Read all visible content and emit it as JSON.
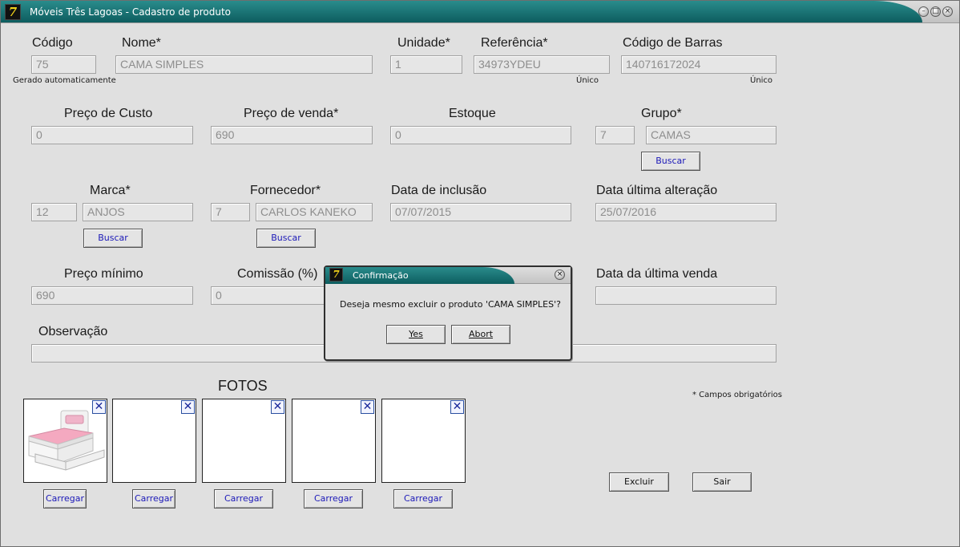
{
  "window": {
    "title": "Móveis Três Lagoas - Cadastro de produto",
    "logo": "7"
  },
  "form": {
    "codigo": {
      "label": "Código",
      "value": "75",
      "hint": "Gerado automaticamente"
    },
    "nome": {
      "label": "Nome*",
      "value": "CAMA SIMPLES"
    },
    "unidade": {
      "label": "Unidade*",
      "value": "1"
    },
    "referencia": {
      "label": "Referência*",
      "value": "34973YDEU",
      "hint": "Único"
    },
    "codigo_barras": {
      "label": "Código de Barras",
      "value": "140716172024",
      "hint": "Único"
    },
    "preco_custo": {
      "label": "Preço de Custo",
      "value": "0"
    },
    "preco_venda": {
      "label": "Preço de venda*",
      "value": "690"
    },
    "estoque": {
      "label": "Estoque",
      "value": "0"
    },
    "grupo": {
      "label": "Grupo*",
      "id": "7",
      "name": "CAMAS",
      "search_label": "Buscar"
    },
    "marca": {
      "label": "Marca*",
      "id": "12",
      "name": "ANJOS",
      "search_label": "Buscar"
    },
    "fornecedor": {
      "label": "Fornecedor*",
      "id": "7",
      "name": "CARLOS KANEKO",
      "search_label": "Buscar"
    },
    "data_inclusao": {
      "label": "Data de inclusão",
      "value": "07/07/2015"
    },
    "data_alteracao": {
      "label": "Data última alteração",
      "value": "25/07/2016"
    },
    "preco_minimo": {
      "label": "Preço mínimo",
      "value": "690"
    },
    "comissao": {
      "label": "Comissão (%)",
      "value": "0"
    },
    "data_ultima_venda": {
      "label": "Data da última venda",
      "value": ""
    },
    "observacao": {
      "label": "Observação",
      "value": ""
    },
    "required_note": "* Campos obrigatórios"
  },
  "photos": {
    "title": "FOTOS",
    "upload_label": "Carregar",
    "remove_label": "✕",
    "items": [
      {
        "has_image": true,
        "image": "bed-photo"
      },
      {
        "has_image": false
      },
      {
        "has_image": false
      },
      {
        "has_image": false
      },
      {
        "has_image": false
      }
    ]
  },
  "actions": {
    "delete_label": "Excluir",
    "exit_label": "Sair"
  },
  "dialog": {
    "title": "Confirmação",
    "message": "Deseja mesmo excluir o produto 'CAMA SIMPLES'?",
    "yes_label": "Yes",
    "abort_label": "Abort"
  },
  "colors": {
    "title_bar": "#0d5d5f",
    "button_text": "#1b18b8",
    "window_bg": "#e0e0e0"
  }
}
